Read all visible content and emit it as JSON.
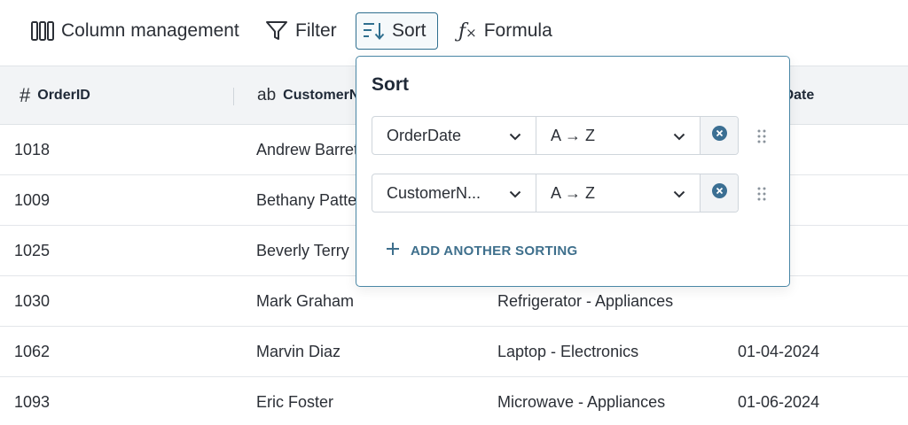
{
  "toolbar": {
    "column_management": {
      "label": "Column management",
      "icon": "columns-icon"
    },
    "filter": {
      "label": "Filter",
      "icon": "filter-icon"
    },
    "sort": {
      "label": "Sort",
      "icon": "sort-icon",
      "active": true
    },
    "formula": {
      "label": "Formula",
      "icon": "formula-icon"
    }
  },
  "table": {
    "columns": [
      {
        "type_icon": "#",
        "label": "OrderID"
      },
      {
        "type_icon": "ab",
        "label": "CustomerName"
      },
      {
        "type_icon": "",
        "label": ""
      },
      {
        "type_icon": "",
        "label": "OrderDate"
      }
    ],
    "rows": [
      [
        "1018",
        "Andrew Barrett",
        "",
        ""
      ],
      [
        "1009",
        "Bethany Patterson",
        "",
        ""
      ],
      [
        "1025",
        "Beverly Terry",
        "",
        ""
      ],
      [
        "1030",
        "Mark Graham",
        "Refrigerator - Appliances",
        ""
      ],
      [
        "1062",
        "Marvin Diaz",
        "Laptop - Electronics",
        "01-04-2024"
      ],
      [
        "1093",
        "Eric Foster",
        "Microwave - Appliances",
        "01-06-2024"
      ]
    ]
  },
  "sort_popover": {
    "title": "Sort",
    "rules": [
      {
        "field": "OrderDate",
        "direction": "A → Z"
      },
      {
        "field": "CustomerN...",
        "direction": "A → Z"
      }
    ],
    "add_label": "ADD ANOTHER SORTING"
  },
  "colors": {
    "accent": "#2f6f8f",
    "header_bg": "#f2f4f6",
    "clear_icon": "#3b6f93"
  }
}
